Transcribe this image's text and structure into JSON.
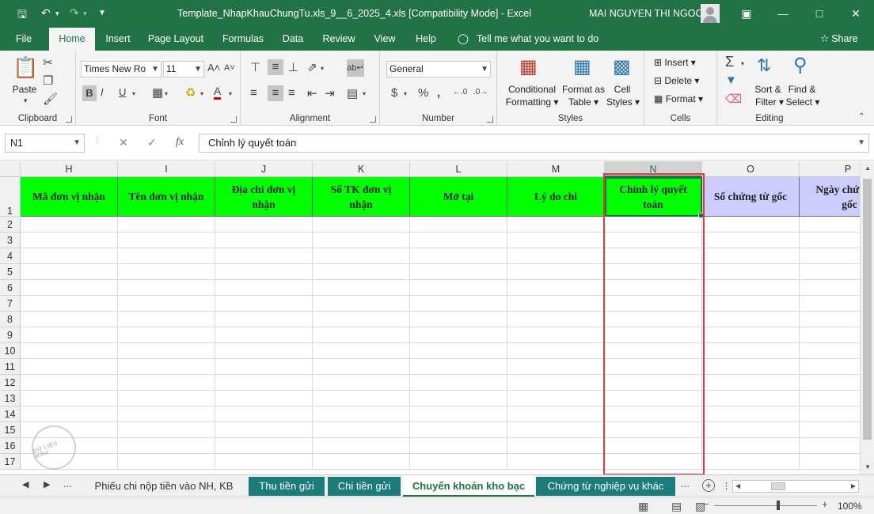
{
  "window": {
    "title": "Template_NhapKhauChungTu.xls_9__6_2025_4.xls  [Compatibility Mode]  -  Excel",
    "user": "MAI NGUYEN THI NGOC"
  },
  "menu": {
    "tabs": [
      "File",
      "Home",
      "Insert",
      "Page Layout",
      "Formulas",
      "Data",
      "Review",
      "View",
      "Help"
    ],
    "active": "Home",
    "tell_me": "Tell me what you want to do",
    "share": "Share"
  },
  "ribbon": {
    "clipboard": {
      "label": "Clipboard",
      "paste": "Paste"
    },
    "font": {
      "label": "Font",
      "font_name": "Times New Ro",
      "font_size": "11"
    },
    "alignment": {
      "label": "Alignment"
    },
    "number": {
      "label": "Number",
      "format": "General"
    },
    "styles": {
      "label": "Styles",
      "conditional": "Conditional",
      "conditional2": "Formatting",
      "format_as": "Format as",
      "format_as2": "Table",
      "cell": "Cell",
      "cell2": "Styles"
    },
    "cells": {
      "label": "Cells",
      "insert": "Insert",
      "delete": "Delete",
      "format": "Format"
    },
    "editing": {
      "label": "Editing",
      "sort": "Sort &",
      "sort2": "Filter",
      "find": "Find &",
      "find2": "Select"
    }
  },
  "formula_bar": {
    "name_box": "N1",
    "fx": "fx",
    "content": "Chỉnh lý quyết toán"
  },
  "grid": {
    "columns": [
      "H",
      "I",
      "J",
      "K",
      "L",
      "M",
      "N",
      "O",
      "P"
    ],
    "active_column": "N",
    "rows": [
      "1",
      "2",
      "3",
      "4",
      "5",
      "6",
      "7",
      "8",
      "9",
      "10",
      "11",
      "12",
      "13",
      "14",
      "15",
      "16",
      "17"
    ],
    "headers": [
      "Mã đơn vị nhận",
      "Tên đơn vị nhận",
      "Địa chỉ đơn vị nhận",
      "Số TK đơn vị nhận",
      "Mở tại",
      "Lý do chi",
      "Chỉnh lý quyết toán",
      "Số chứng từ gốc",
      "Ngày chứng từ gốc"
    ],
    "header_colors": {
      "green": "#00ff00",
      "purple": "#ccccff"
    },
    "watermark": "DỮ LIỆU MẪU"
  },
  "sheets": {
    "more": "...",
    "tabs": [
      "Phiếu chi nộp tiền vào NH, KB",
      "Thu tiền gửi",
      "Chi tiền gửi",
      "Chuyển khoản kho bạc",
      "Chứng từ nghiệp vụ khác"
    ],
    "active": "Chuyển khoản kho bạc",
    "more_right": "..."
  },
  "status": {
    "zoom": "100%"
  }
}
